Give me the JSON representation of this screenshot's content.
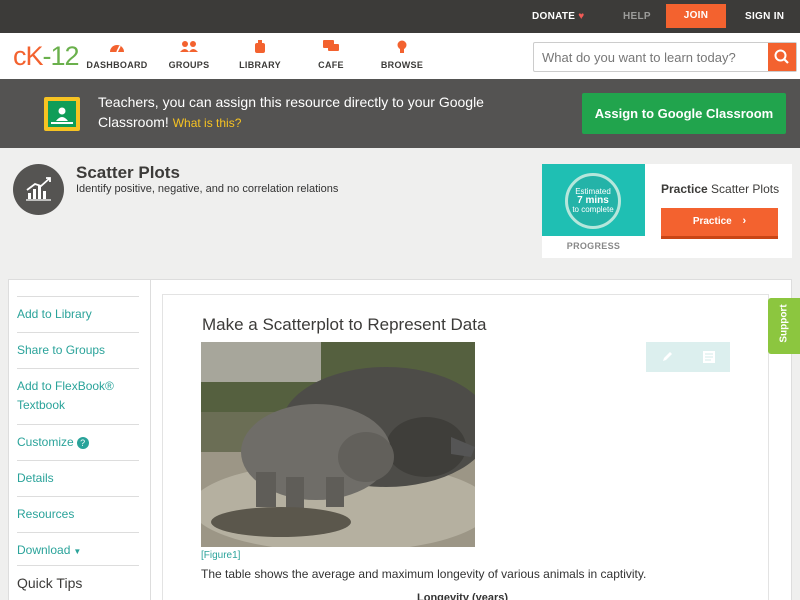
{
  "topbar": {
    "donate": "DONATE",
    "help": "HELP",
    "join": "JOIN",
    "signin": "SIGN IN"
  },
  "nav": {
    "logo": {
      "c": "c",
      "k": "K",
      "n": "-12"
    },
    "items": [
      {
        "label": "DASHBOARD",
        "icon": "dashboard-icon"
      },
      {
        "label": "GROUPS",
        "icon": "groups-icon"
      },
      {
        "label": "LIBRARY",
        "icon": "library-icon"
      },
      {
        "label": "CAFE",
        "icon": "cafe-icon"
      },
      {
        "label": "BROWSE",
        "icon": "browse-icon"
      }
    ],
    "search_placeholder": "What do you want to learn today?"
  },
  "banner": {
    "text": "Teachers, you can assign this resource directly to your Google Classroom!",
    "what": "What is this?",
    "assign_label": "Assign to Google Classroom"
  },
  "concept": {
    "title": "Scatter Plots",
    "subtitle": "Identify positive, negative, and no correlation relations"
  },
  "practice": {
    "estimated": "Estimated",
    "mins": "7 mins",
    "to_complete": "to complete",
    "progress_label": "PROGRESS",
    "title_bold": "Practice",
    "title_rest": "Scatter Plots",
    "button": "Practice"
  },
  "sidebar": {
    "items": [
      {
        "label": "Add to Library"
      },
      {
        "label": "Share to Groups"
      },
      {
        "label": "Add to FlexBook® Textbook"
      },
      {
        "label": "Customize"
      },
      {
        "label": "Details"
      },
      {
        "label": "Resources"
      },
      {
        "label": "Download"
      }
    ],
    "help_glyph": "?",
    "quick_tips": "Quick Tips"
  },
  "content": {
    "title": "Make a Scatterplot to Represent Data",
    "figure_caption": "[Figure1]",
    "paragraph": "The table shows the average and maximum longevity of various animals in captivity.",
    "table_heading": "Longevity (years)"
  },
  "support": "Support",
  "colors": {
    "accent": "#f3622f",
    "teal": "#2aa39a",
    "green": "#21a44d",
    "dark": "#3c3b39"
  }
}
